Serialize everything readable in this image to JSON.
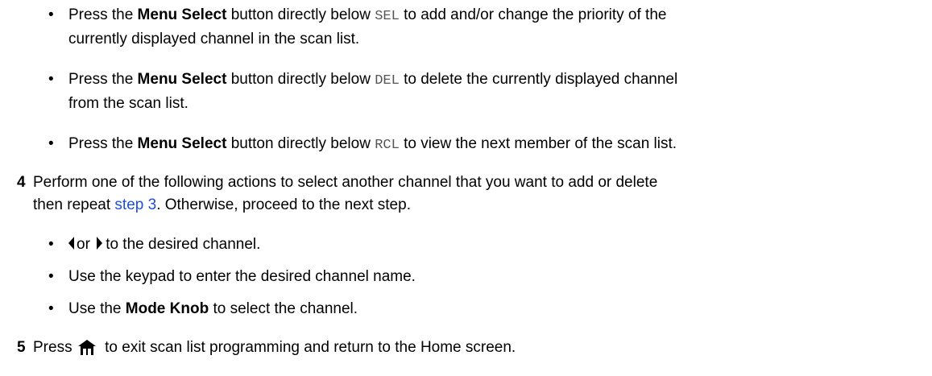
{
  "bullets_step3": [
    {
      "bullet": "•",
      "prefix": "Press the ",
      "bold": "Menu Select",
      "middle": " button directly below ",
      "code": "SEL",
      "suffix_line1": " to add and/or change the priority of the",
      "line2": "currently displayed channel in the scan list."
    },
    {
      "bullet": "•",
      "prefix": "Press the ",
      "bold": "Menu Select",
      "middle": " button directly below ",
      "code": "DEL",
      "suffix_line1": " to delete the currently displayed channel",
      "line2": "from the scan list."
    },
    {
      "bullet": "•",
      "prefix": "Press the ",
      "bold": "Menu Select",
      "middle": " button directly below ",
      "code": "RCL",
      "suffix_line1": " to view the next member of the scan list."
    }
  ],
  "step4": {
    "number": "4",
    "line1": "Perform one of the following actions to select another channel that you want to add or delete",
    "line2_prefix": "then repeat ",
    "link": "step 3",
    "line2_suffix": ". Otherwise, proceed to the next step."
  },
  "bullets_step4": [
    {
      "bullet": "•",
      "or": "or",
      "text": "to the desired channel.",
      "left_icon": "left-arrow-icon",
      "right_icon": "right-arrow-icon"
    },
    {
      "bullet": "•",
      "text": "Use the keypad to enter the desired channel name."
    },
    {
      "bullet": "•",
      "prefix": "Use the ",
      "bold": "Mode Knob",
      "suffix": " to select the channel."
    }
  ],
  "step5": {
    "number": "5",
    "prefix": "Press ",
    "icon": "home-icon",
    "suffix": " to exit scan list programming and return to the Home screen."
  },
  "colors": {
    "text": "#000000",
    "link": "#1f4fd8",
    "code": "#555555"
  }
}
